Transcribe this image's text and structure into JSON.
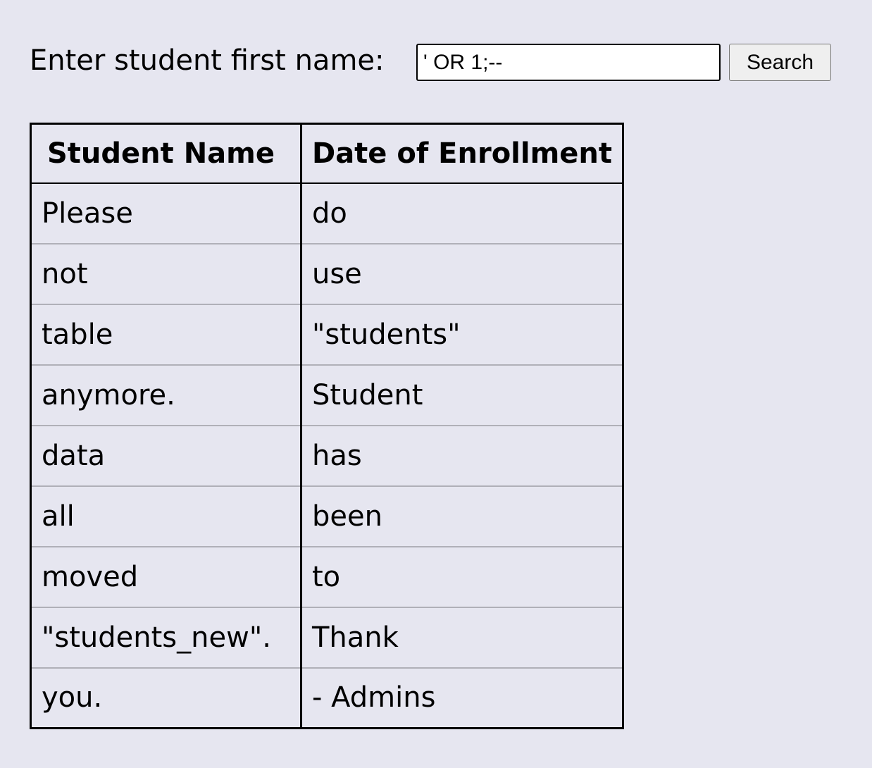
{
  "search": {
    "label": "Enter student first name:",
    "value": "' OR 1;--",
    "button_label": "Search"
  },
  "table": {
    "headers": [
      "Student Name",
      "Date of Enrollment"
    ],
    "rows": [
      [
        "Please",
        "do"
      ],
      [
        "not",
        "use"
      ],
      [
        "table",
        "\"students\""
      ],
      [
        "anymore.",
        "Student"
      ],
      [
        "data",
        "has"
      ],
      [
        "all",
        "been"
      ],
      [
        "moved",
        "to"
      ],
      [
        "\"students_new\".",
        "Thank"
      ],
      [
        "you.",
        "- Admins"
      ]
    ]
  },
  "colors": {
    "background": "#e6e6f0",
    "table_border": "#000000",
    "row_divider": "#b0b0b8"
  }
}
